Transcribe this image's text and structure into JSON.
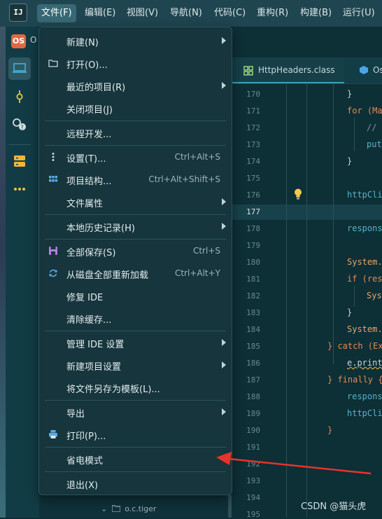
{
  "app": {
    "logo_text": "IJ"
  },
  "menubar": {
    "items": [
      {
        "label": "文件(F)"
      },
      {
        "label": "编辑(E)"
      },
      {
        "label": "视图(V)"
      },
      {
        "label": "导航(N)"
      },
      {
        "label": "代码(C)"
      },
      {
        "label": "重构(R)"
      },
      {
        "label": "构建(B)"
      },
      {
        "label": "运行(U)"
      }
    ]
  },
  "sidebar": {
    "project_badge": "OS",
    "project_name": "O",
    "tools": [
      "project-icon",
      "commit-icon",
      "services-icon",
      "database-icon",
      "more-icon"
    ]
  },
  "editor": {
    "tabs": [
      {
        "label": "HttpHeaders.class"
      },
      {
        "label": "Os"
      }
    ],
    "lines": [
      {
        "no": "170",
        "text": "}"
      },
      {
        "no": "171",
        "text": "for (Ma"
      },
      {
        "no": "172",
        "text": "//"
      },
      {
        "no": "173",
        "text": "put"
      },
      {
        "no": "174",
        "text": "}"
      },
      {
        "no": "175",
        "text": ""
      },
      {
        "no": "176",
        "text": "httpCli"
      },
      {
        "no": "177",
        "text": ""
      },
      {
        "no": "178",
        "text": "respons"
      },
      {
        "no": "179",
        "text": ""
      },
      {
        "no": "180",
        "text": "System."
      },
      {
        "no": "181",
        "text": "if (res"
      },
      {
        "no": "182",
        "text": "Sys"
      },
      {
        "no": "183",
        "text": "}"
      },
      {
        "no": "184",
        "text": "System."
      },
      {
        "no": "185",
        "text": "} catch (Ex"
      },
      {
        "no": "186",
        "text": "e.print"
      },
      {
        "no": "187",
        "text": "} finally {"
      },
      {
        "no": "188",
        "text": "respons"
      },
      {
        "no": "189",
        "text": "httpCli"
      },
      {
        "no": "190",
        "text": "}"
      },
      {
        "no": "191",
        "text": ""
      },
      {
        "no": "192",
        "text": ""
      },
      {
        "no": "193",
        "text": ""
      },
      {
        "no": "194",
        "text": ""
      },
      {
        "no": "195",
        "text": ""
      }
    ]
  },
  "file_menu": {
    "items": [
      {
        "label": "新建(N)",
        "submenu": true
      },
      {
        "label": "打开(O)...",
        "icon": "folder-icon"
      },
      {
        "label": "最近的项目(R)",
        "submenu": true
      },
      {
        "label": "关闭项目(J)"
      },
      {
        "label": "远程开发..."
      },
      {
        "label": "设置(T)...",
        "shortcut": "Ctrl+Alt+S",
        "icon": "settings-dots-icon"
      },
      {
        "label": "项目结构...",
        "shortcut": "Ctrl+Alt+Shift+S",
        "icon": "project-structure-icon"
      },
      {
        "label": "文件属性",
        "submenu": true
      },
      {
        "label": "本地历史记录(H)",
        "submenu": true
      },
      {
        "label": "全部保存(S)",
        "shortcut": "Ctrl+S",
        "icon": "save-icon"
      },
      {
        "label": "从磁盘全部重新加载",
        "shortcut": "Ctrl+Alt+Y",
        "icon": "reload-icon"
      },
      {
        "label": "修复 IDE"
      },
      {
        "label": "清除缓存..."
      },
      {
        "label": "管理 IDE 设置",
        "submenu": true
      },
      {
        "label": "新建项目设置",
        "submenu": true
      },
      {
        "label": "将文件另存为模板(L)..."
      },
      {
        "label": "导出",
        "submenu": true
      },
      {
        "label": "打印(P)...",
        "icon": "print-icon"
      },
      {
        "label": "省电模式"
      },
      {
        "label": "退出(X)"
      }
    ]
  },
  "project_tree": {
    "visible_node": "o.c.tiger"
  },
  "watermark": "CSDN @猫头虎",
  "colors": {
    "menubar_bg": "#1f4550",
    "menu_bg": "#16353c",
    "editor_bg": "#0d2f36",
    "accent": "#3aa0b5",
    "annotation_arrow": "#e8332b"
  }
}
